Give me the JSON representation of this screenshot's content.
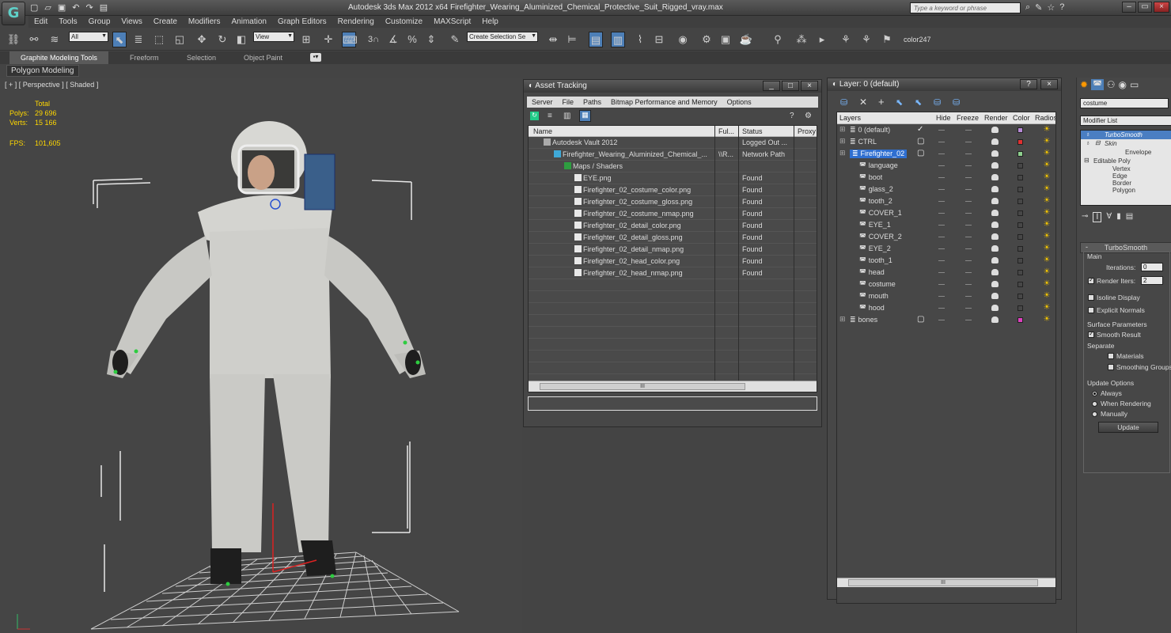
{
  "app": {
    "logo": "G",
    "window_title": "Autodesk 3ds Max  2012 x64      Firefighter_Wearing_Aluminized_Chemical_Protective_Suit_Rigged_vray.max",
    "search_placeholder": "Type a keyword or phrase"
  },
  "menu": [
    "Edit",
    "Tools",
    "Group",
    "Views",
    "Create",
    "Modifiers",
    "Animation",
    "Graph Editors",
    "Rendering",
    "Customize",
    "MAXScript",
    "Help"
  ],
  "toolbar": {
    "filter_value": "All",
    "refcoord_value": "View",
    "snap_label": "3",
    "selection_set_placeholder": "Create Selection Se",
    "color_label": "color247"
  },
  "ribbon": {
    "tabs": [
      "Graphite Modeling Tools",
      "Freeform",
      "Selection",
      "Object Paint"
    ],
    "sub_label": "Polygon Modeling"
  },
  "viewport": {
    "label": "[ + ] [ Perspective ] [ Shaded ]",
    "stats_header": "Total",
    "polys_label": "Polys:",
    "polys_value": "29 696",
    "verts_label": "Verts:",
    "verts_value": "15 166",
    "fps_label": "FPS:",
    "fps_value": "101,605"
  },
  "asset_tracking": {
    "title": "Asset Tracking",
    "menu": [
      "Server",
      "File",
      "Paths",
      "Bitmap Performance and Memory",
      "Options"
    ],
    "columns": [
      "Name",
      "Ful...",
      "Status",
      "Proxy"
    ],
    "rows": [
      {
        "name": "Autodesk Vault 2012",
        "full": "",
        "status": "Logged Out ...",
        "indent": 1
      },
      {
        "name": "Firefighter_Wearing_Aluminized_Chemical_...",
        "full": "\\\\R...",
        "status": "Network Path",
        "indent": 2
      },
      {
        "name": "Maps / Shaders",
        "full": "",
        "status": "",
        "indent": 3
      },
      {
        "name": "EYE.png",
        "full": "",
        "status": "Found",
        "indent": 4
      },
      {
        "name": "Firefighter_02_costume_color.png",
        "full": "",
        "status": "Found",
        "indent": 4
      },
      {
        "name": "Firefighter_02_costume_gloss.png",
        "full": "",
        "status": "Found",
        "indent": 4
      },
      {
        "name": "Firefighter_02_costume_nmap.png",
        "full": "",
        "status": "Found",
        "indent": 4
      },
      {
        "name": "Firefighter_02_detail_color.png",
        "full": "",
        "status": "Found",
        "indent": 4
      },
      {
        "name": "Firefighter_02_detail_gloss.png",
        "full": "",
        "status": "Found",
        "indent": 4
      },
      {
        "name": "Firefighter_02_detail_nmap.png",
        "full": "",
        "status": "Found",
        "indent": 4
      },
      {
        "name": "Firefighter_02_head_color.png",
        "full": "",
        "status": "Found",
        "indent": 4
      },
      {
        "name": "Firefighter_02_head_nmap.png",
        "full": "",
        "status": "Found",
        "indent": 4
      }
    ],
    "scroll_marker": "III"
  },
  "layers": {
    "title": "Layer: 0 (default)",
    "help": "?",
    "columns": [
      "Layers",
      "Hide",
      "Freeze",
      "Render",
      "Color",
      "Radiosi"
    ],
    "rows": [
      {
        "name": "0 (default)",
        "indent": 1,
        "color": "#b88ad8",
        "mark": "check"
      },
      {
        "name": "CTRL",
        "indent": 1,
        "color": "#e03030",
        "mark": "box"
      },
      {
        "name": "Firefighter_02",
        "indent": 1,
        "color": "#8ed08e",
        "mark": "box",
        "selected": true
      },
      {
        "name": "language",
        "indent": 2,
        "color": ""
      },
      {
        "name": "boot",
        "indent": 2,
        "color": ""
      },
      {
        "name": "glass_2",
        "indent": 2,
        "color": ""
      },
      {
        "name": "tooth_2",
        "indent": 2,
        "color": ""
      },
      {
        "name": "COVER_1",
        "indent": 2,
        "color": ""
      },
      {
        "name": "EYE_1",
        "indent": 2,
        "color": ""
      },
      {
        "name": "COVER_2",
        "indent": 2,
        "color": ""
      },
      {
        "name": "EYE_2",
        "indent": 2,
        "color": ""
      },
      {
        "name": "tooth_1",
        "indent": 2,
        "color": ""
      },
      {
        "name": "head",
        "indent": 2,
        "color": ""
      },
      {
        "name": "costume",
        "indent": 2,
        "color": ""
      },
      {
        "name": "mouth",
        "indent": 2,
        "color": ""
      },
      {
        "name": "hood",
        "indent": 2,
        "color": ""
      },
      {
        "name": "bones",
        "indent": 1,
        "color": "#e040c0",
        "mark": "box"
      }
    ],
    "scroll_marker": "III"
  },
  "modify_panel": {
    "object_name": "costume",
    "modifier_list": "Modifier List",
    "stack": [
      "TurboSmooth",
      "Skin",
      "Envelope",
      "Editable Poly",
      "Vertex",
      "Edge",
      "Border",
      "Polygon"
    ],
    "rollout_title": "TurboSmooth",
    "main_label": "Main",
    "iterations_label": "Iterations:",
    "iterations_value": "0",
    "render_iters_label": "Render Iters:",
    "render_iters_value": "2",
    "isoline_label": "Isoline Display",
    "explicit_normals_label": "Explicit Normals",
    "surface_params_label": "Surface Parameters",
    "smooth_result_label": "Smooth Result",
    "separate_label": "Separate",
    "materials_label": "Materials",
    "smoothing_groups_label": "Smoothing Groups",
    "update_options_label": "Update Options",
    "always_label": "Always",
    "when_rendering_label": "When Rendering",
    "manually_label": "Manually",
    "update_button": "Update"
  }
}
